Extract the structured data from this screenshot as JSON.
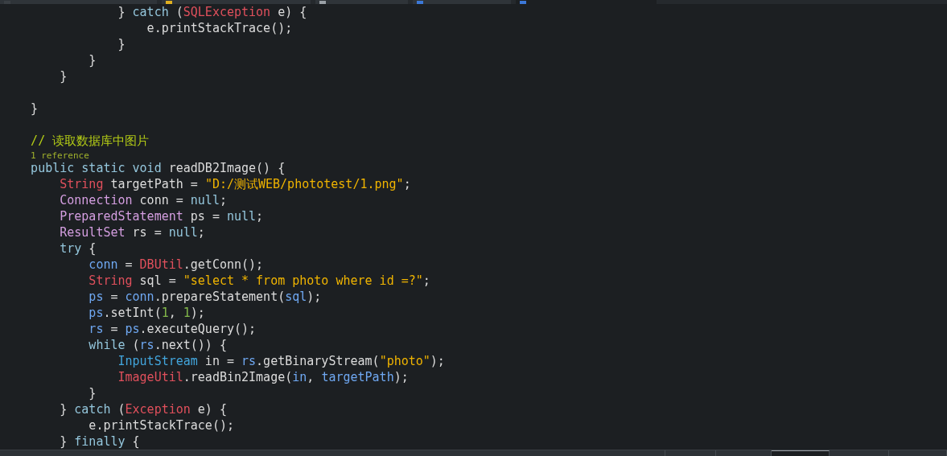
{
  "editor_tabs": [
    {
      "selected": false,
      "color": "#3a3f44"
    },
    {
      "selected": false,
      "color": "#e0b020"
    },
    {
      "selected": false,
      "color": "#9aa0a6"
    },
    {
      "selected": false,
      "color": "#3c78d8"
    },
    {
      "selected": true,
      "color": "#3c78d8"
    }
  ],
  "code_lines": [
    {
      "kind": "code",
      "tokens": [
        {
          "text": "                } ",
          "kind": "plain"
        },
        {
          "text": "catch",
          "kind": "kw"
        },
        {
          "text": " (",
          "kind": "plain"
        },
        {
          "text": "SQLException",
          "kind": "type"
        },
        {
          "text": " e) {",
          "kind": "plain"
        }
      ]
    },
    {
      "kind": "code",
      "tokens": [
        {
          "text": "                    e.printStackTrace();",
          "kind": "plain"
        }
      ]
    },
    {
      "kind": "code",
      "tokens": [
        {
          "text": "                }",
          "kind": "plain"
        }
      ]
    },
    {
      "kind": "code",
      "tokens": [
        {
          "text": "            }",
          "kind": "plain"
        }
      ]
    },
    {
      "kind": "code",
      "tokens": [
        {
          "text": "        }",
          "kind": "plain"
        }
      ]
    },
    {
      "kind": "blank"
    },
    {
      "kind": "code",
      "tokens": [
        {
          "text": "    }",
          "kind": "plain"
        }
      ]
    },
    {
      "kind": "blank"
    },
    {
      "kind": "code",
      "tokens": [
        {
          "text": "    // 读取数据库中图片",
          "kind": "comment"
        }
      ]
    },
    {
      "kind": "codelens",
      "text": "1 reference"
    },
    {
      "kind": "code",
      "tokens": [
        {
          "text": "    public static void",
          "kind": "kw"
        },
        {
          "text": " readDB2Image() {",
          "kind": "plain"
        }
      ]
    },
    {
      "kind": "code",
      "tokens": [
        {
          "text": "        String",
          "kind": "type"
        },
        {
          "text": " targetPath = ",
          "kind": "plain"
        },
        {
          "text": "\"D:/测试WEB/phototest/1.png\"",
          "kind": "str"
        },
        {
          "text": ";",
          "kind": "plain"
        }
      ]
    },
    {
      "kind": "code",
      "tokens": [
        {
          "text": "        Connection",
          "kind": "iface"
        },
        {
          "text": " conn = ",
          "kind": "plain"
        },
        {
          "text": "null",
          "kind": "kw"
        },
        {
          "text": ";",
          "kind": "plain"
        }
      ]
    },
    {
      "kind": "code",
      "tokens": [
        {
          "text": "        PreparedStatement",
          "kind": "iface"
        },
        {
          "text": " ps = ",
          "kind": "plain"
        },
        {
          "text": "null",
          "kind": "kw"
        },
        {
          "text": ";",
          "kind": "plain"
        }
      ]
    },
    {
      "kind": "code",
      "tokens": [
        {
          "text": "        ResultSet",
          "kind": "iface"
        },
        {
          "text": " rs = ",
          "kind": "plain"
        },
        {
          "text": "null",
          "kind": "kw"
        },
        {
          "text": ";",
          "kind": "plain"
        }
      ]
    },
    {
      "kind": "code",
      "tokens": [
        {
          "text": "        try",
          "kind": "kw"
        },
        {
          "text": " {",
          "kind": "plain"
        }
      ]
    },
    {
      "kind": "code",
      "tokens": [
        {
          "text": "            conn",
          "kind": "var"
        },
        {
          "text": " = ",
          "kind": "plain"
        },
        {
          "text": "DBUtil",
          "kind": "type"
        },
        {
          "text": ".getConn();",
          "kind": "plain"
        }
      ]
    },
    {
      "kind": "code",
      "tokens": [
        {
          "text": "            String",
          "kind": "type"
        },
        {
          "text": " sql = ",
          "kind": "plain"
        },
        {
          "text": "\"select * from photo where id =?\"",
          "kind": "str"
        },
        {
          "text": ";",
          "kind": "plain"
        }
      ]
    },
    {
      "kind": "code",
      "tokens": [
        {
          "text": "            ps",
          "kind": "var"
        },
        {
          "text": " = ",
          "kind": "plain"
        },
        {
          "text": "conn",
          "kind": "var"
        },
        {
          "text": ".prepareStatement(",
          "kind": "plain"
        },
        {
          "text": "sql",
          "kind": "var"
        },
        {
          "text": ");",
          "kind": "plain"
        }
      ]
    },
    {
      "kind": "code",
      "tokens": [
        {
          "text": "            ps",
          "kind": "var"
        },
        {
          "text": ".setInt(",
          "kind": "plain"
        },
        {
          "text": "1",
          "kind": "num"
        },
        {
          "text": ", ",
          "kind": "plain"
        },
        {
          "text": "1",
          "kind": "num"
        },
        {
          "text": ");",
          "kind": "plain"
        }
      ]
    },
    {
      "kind": "code",
      "tokens": [
        {
          "text": "            rs",
          "kind": "var"
        },
        {
          "text": " = ",
          "kind": "plain"
        },
        {
          "text": "ps",
          "kind": "var"
        },
        {
          "text": ".executeQuery();",
          "kind": "plain"
        }
      ]
    },
    {
      "kind": "code",
      "tokens": [
        {
          "text": "            while",
          "kind": "kw"
        },
        {
          "text": " (",
          "kind": "plain"
        },
        {
          "text": "rs",
          "kind": "var"
        },
        {
          "text": ".next()) {",
          "kind": "plain"
        }
      ]
    },
    {
      "kind": "code",
      "tokens": [
        {
          "text": "                InputStream",
          "kind": "cls"
        },
        {
          "text": " in = ",
          "kind": "plain"
        },
        {
          "text": "rs",
          "kind": "var"
        },
        {
          "text": ".getBinaryStream(",
          "kind": "plain"
        },
        {
          "text": "\"photo\"",
          "kind": "str"
        },
        {
          "text": ");",
          "kind": "plain"
        }
      ]
    },
    {
      "kind": "code",
      "tokens": [
        {
          "text": "                ImageUtil",
          "kind": "type"
        },
        {
          "text": ".readBin2Image(",
          "kind": "plain"
        },
        {
          "text": "in",
          "kind": "var"
        },
        {
          "text": ", ",
          "kind": "plain"
        },
        {
          "text": "targetPath",
          "kind": "var"
        },
        {
          "text": ");",
          "kind": "plain"
        }
      ]
    },
    {
      "kind": "code",
      "tokens": [
        {
          "text": "            }",
          "kind": "plain"
        }
      ]
    },
    {
      "kind": "code",
      "tokens": [
        {
          "text": "        } ",
          "kind": "plain"
        },
        {
          "text": "catch",
          "kind": "kw"
        },
        {
          "text": " (",
          "kind": "plain"
        },
        {
          "text": "Exception",
          "kind": "type"
        },
        {
          "text": " e) {",
          "kind": "plain"
        }
      ]
    },
    {
      "kind": "code",
      "tokens": [
        {
          "text": "            e.printStackTrace();",
          "kind": "plain"
        }
      ]
    },
    {
      "kind": "code",
      "tokens": [
        {
          "text": "        } ",
          "kind": "plain"
        },
        {
          "text": "finally",
          "kind": "kw"
        },
        {
          "text": " {",
          "kind": "plain"
        }
      ]
    }
  ],
  "panel_tabs": [
    {
      "selected": false
    },
    {
      "selected": false
    },
    {
      "selected": false
    },
    {
      "selected": true
    },
    {
      "selected": false
    },
    {
      "selected": false
    }
  ]
}
